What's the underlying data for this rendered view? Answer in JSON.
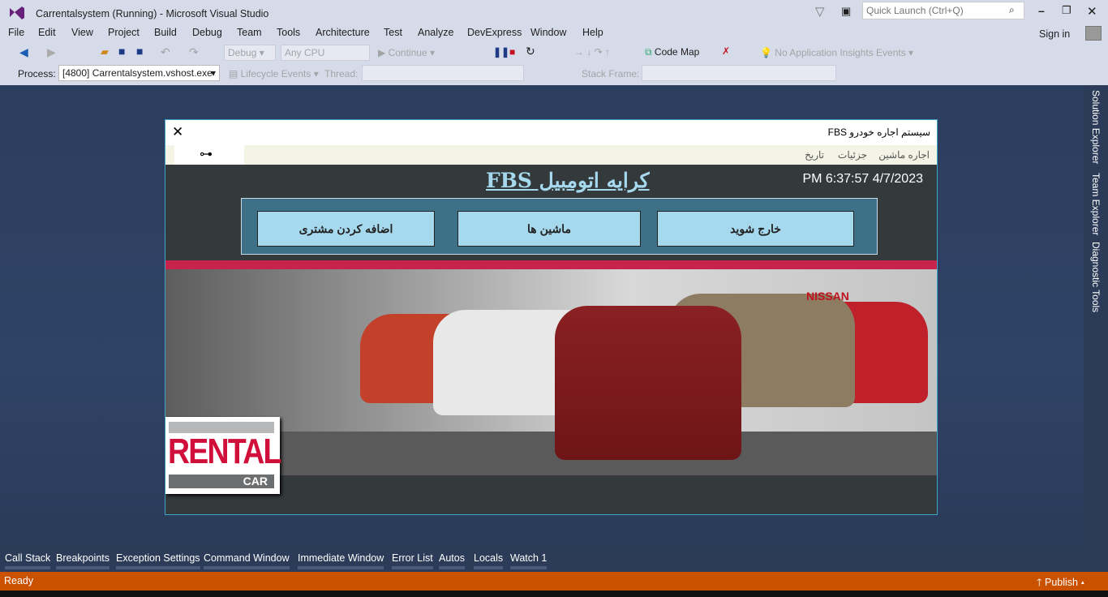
{
  "window": {
    "title": "Carrentalsystem (Running) - Microsoft Visual Studio",
    "quick_launch_placeholder": "Quick Launch (Ctrl+Q)",
    "sign_in": "Sign in"
  },
  "menu": [
    "File",
    "Edit",
    "View",
    "Project",
    "Build",
    "Debug",
    "Team",
    "Tools",
    "Architecture",
    "Test",
    "Analyze",
    "DevExpress",
    "Window",
    "Help"
  ],
  "toolbar": {
    "config": "Debug",
    "platform": "Any CPU",
    "continue": "Continue",
    "code_map": "Code Map",
    "insights": "No Application Insights Events"
  },
  "debug_bar": {
    "process_label": "Process:",
    "process_value": "[4800] Carrentalsystem.vshost.exe",
    "lifecycle": "Lifecycle Events",
    "thread_label": "Thread:",
    "stack_frame_label": "Stack Frame:"
  },
  "right_panel": [
    "Solution Explorer",
    "Team Explorer",
    "Diagnostic Tools"
  ],
  "bottom_tabs": [
    "Call Stack",
    "Breakpoints",
    "Exception Settings",
    "Command Window",
    "Immediate Window",
    "Error List",
    "Autos",
    "Locals",
    "Watch 1"
  ],
  "status": {
    "text": "Ready",
    "publish": "Publish"
  },
  "app": {
    "title": "سیستم اجاره خودرو FBS",
    "menu": [
      "اجاره ماشین",
      "جزئیات",
      "تاریخ"
    ],
    "heading": "کرایه اتومبیل FBS",
    "datetime": "PM 6:37:57 4/7/2023",
    "buttons": [
      "خارج شوید",
      "ماشین ها",
      "اضافه کردن مشتری"
    ],
    "logo": {
      "line1": "RENTAL",
      "line2": "CAR"
    }
  },
  "colors": {
    "status_bar": "#ca5100",
    "accent_red": "#c8234a",
    "button_bg": "#a6d8ee",
    "panel_bg": "#3e7088"
  }
}
